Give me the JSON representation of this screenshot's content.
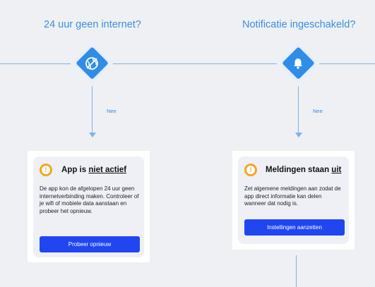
{
  "colors": {
    "background": "#eef0f3",
    "title": "#3c8fde",
    "connector": "#7fb3e6",
    "diamond": "#2f8de8",
    "warning": "#f3a61c",
    "button": "#2146f1"
  },
  "decisions": [
    {
      "question": "24 uur geen internet?",
      "icon": "globe-icon",
      "branch_label": "Nee",
      "card": {
        "icon": "warning-icon",
        "title_prefix": "App is ",
        "title_emphasis": "niet actief",
        "title_suffix": "",
        "body": "De app kon de afgelopen 24 uur geen internetverbinding maken. Controleer of je wifi of mobiele data aanstaan en probeer het opnieuw.",
        "button": "Probeer opnieuw"
      }
    },
    {
      "question": "Notificatie ingeschakeld?",
      "icon": "bell-icon",
      "branch_label": "Nee",
      "card": {
        "icon": "warning-icon",
        "title_prefix": "Meldingen staan ",
        "title_emphasis": "uit",
        "title_suffix": "",
        "body": "Zet algemene meldingen aan zodat de app direct informatie kan delen wanneer dat nodig is.",
        "button": "Instellingen aanzetten"
      }
    }
  ]
}
